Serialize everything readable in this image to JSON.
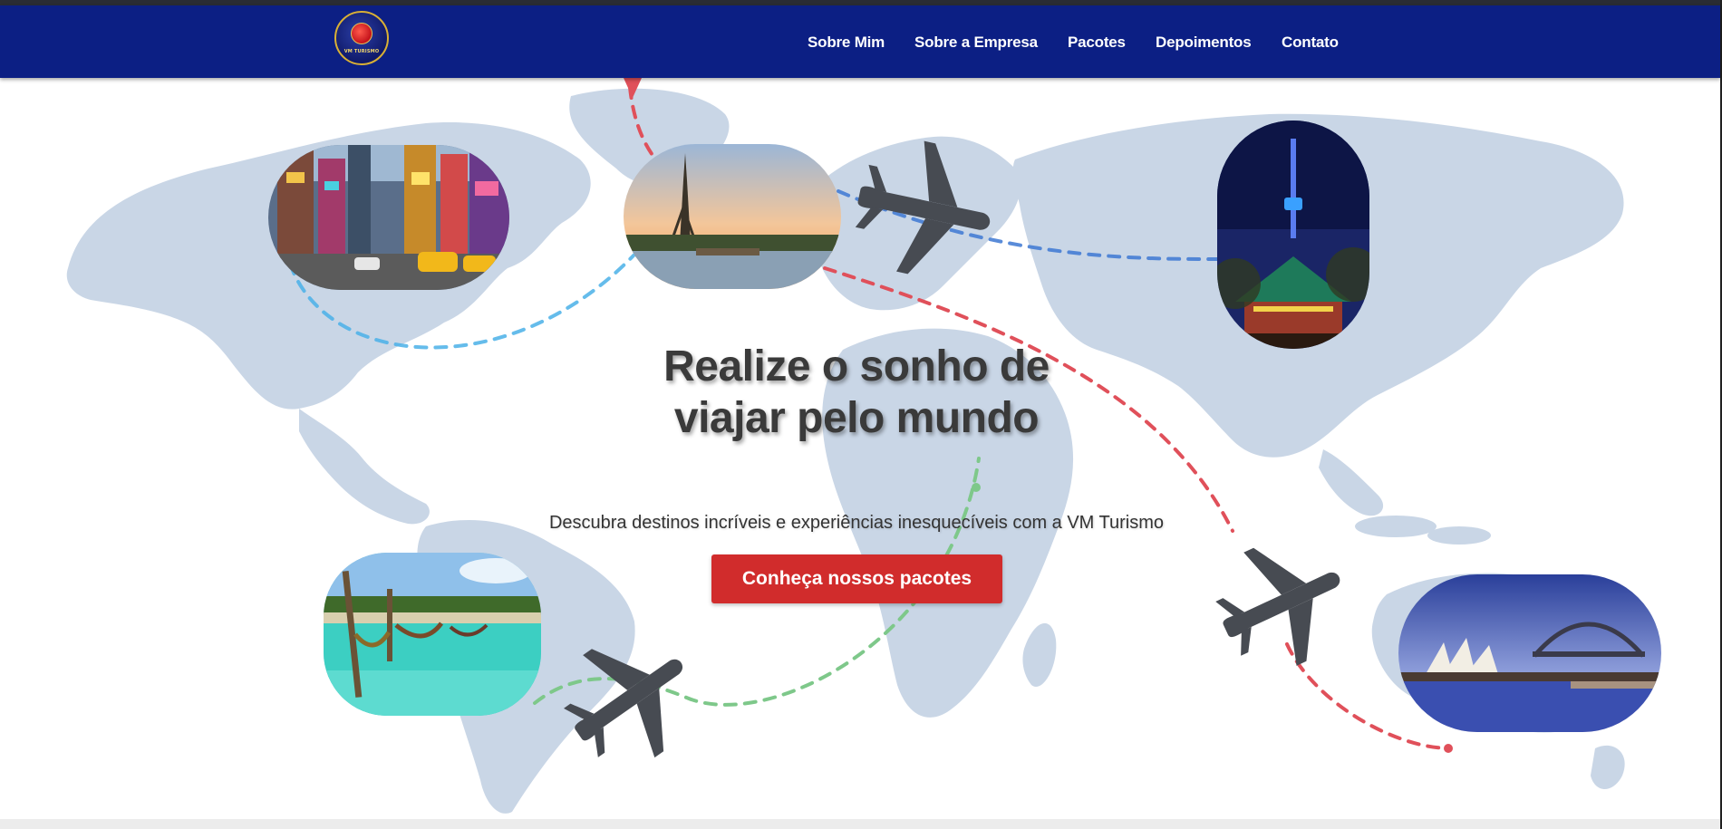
{
  "brand": {
    "logo_text": "VM TURISMO"
  },
  "nav": {
    "items": [
      "Sobre Mim",
      "Sobre a Empresa",
      "Pacotes",
      "Depoimentos",
      "Contato"
    ]
  },
  "hero": {
    "headline": "Realize o sonho de viajar pelo mundo",
    "subtitle": "Descubra destinos incríveis e experiências inesquecíveis com a VM Turismo",
    "cta_label": "Conheça nossos pacotes"
  },
  "colors": {
    "navbar": "#0c1f84",
    "cta": "#d12c2c",
    "map_land": "#c9d6e6",
    "route_red": "#e0505a",
    "route_blue": "#4a8de0",
    "route_green": "#7ec88a",
    "plane": "#474b52"
  },
  "images": [
    {
      "name": "new-york-times-square",
      "icon": "city-photo"
    },
    {
      "name": "paris-eiffel-tower",
      "icon": "eiffel-photo"
    },
    {
      "name": "seoul-tower",
      "icon": "tower-photo"
    },
    {
      "name": "beach-hammocks",
      "icon": "beach-photo"
    },
    {
      "name": "sydney-opera-house",
      "icon": "opera-photo"
    }
  ]
}
